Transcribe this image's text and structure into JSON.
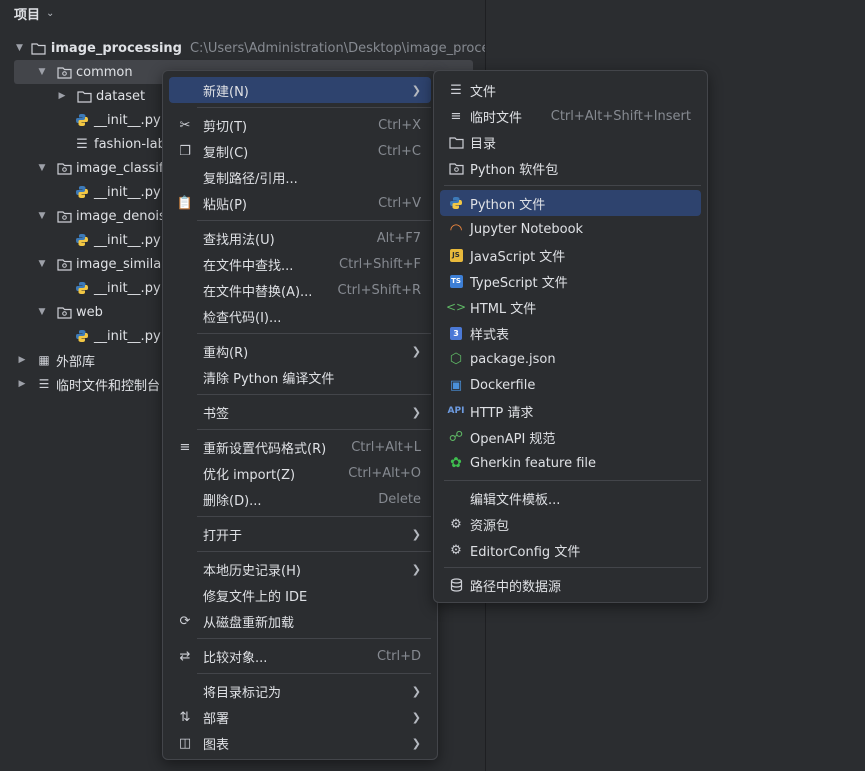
{
  "panel": {
    "title": "项目"
  },
  "tree": {
    "root": {
      "name": "image_processing",
      "path": "C:\\Users\\Administration\\Desktop\\image_processin"
    },
    "common": "common",
    "dataset": "dataset",
    "init": "__init__.py",
    "fashion": "fashion-lab",
    "classification": "image_classifica",
    "denoising": "image_denoisin",
    "similarity": "image_similarit",
    "web": "web",
    "external_libs": "外部库",
    "scratches": "临时文件和控制台"
  },
  "context_menu": {
    "new": "新建(N)",
    "cut": "剪切(T)",
    "cut_sc": "Ctrl+X",
    "copy": "复制(C)",
    "copy_sc": "Ctrl+C",
    "copy_path": "复制路径/引用...",
    "paste": "粘贴(P)",
    "paste_sc": "Ctrl+V",
    "find_usages": "查找用法(U)",
    "find_usages_sc": "Alt+F7",
    "find_in_files": "在文件中查找...",
    "find_in_files_sc": "Ctrl+Shift+F",
    "replace_in_files": "在文件中替换(A)...",
    "replace_in_files_sc": "Ctrl+Shift+R",
    "inspect": "检查代码(I)...",
    "refactor": "重构(R)",
    "clean_python": "清除 Python 编译文件",
    "bookmarks": "书签",
    "reformat": "重新设置代码格式(R)",
    "reformat_sc": "Ctrl+Alt+L",
    "optimize_imports": "优化 import(Z)",
    "optimize_imports_sc": "Ctrl+Alt+O",
    "delete": "删除(D)...",
    "delete_sc": "Delete",
    "open_in": "打开于",
    "local_history": "本地历史记录(H)",
    "repair_ide": "修复文件上的 IDE",
    "reload": "从磁盘重新加载",
    "compare": "比较对象...",
    "compare_sc": "Ctrl+D",
    "mark_dir": "将目录标记为",
    "deploy": "部署",
    "diagrams": "图表"
  },
  "new_submenu": {
    "file": "文件",
    "scratch": "临时文件",
    "scratch_sc": "Ctrl+Alt+Shift+Insert",
    "directory": "目录",
    "python_package": "Python 软件包",
    "python_file": "Python 文件",
    "jupyter": "Jupyter Notebook",
    "javascript": "JavaScript 文件",
    "typescript": "TypeScript 文件",
    "html": "HTML 文件",
    "stylesheet": "样式表",
    "package_json": "package.json",
    "dockerfile": "Dockerfile",
    "http": "HTTP 请求",
    "openapi": "OpenAPI 规范",
    "gherkin": "Gherkin feature file",
    "edit_templates": "编辑文件模板...",
    "resource_bundle": "资源包",
    "editorconfig": "EditorConfig 文件",
    "datasource": "路径中的数据源"
  },
  "colors": {
    "highlight": "#2e436e",
    "selection": "#43454a",
    "background": "#2b2d30"
  }
}
